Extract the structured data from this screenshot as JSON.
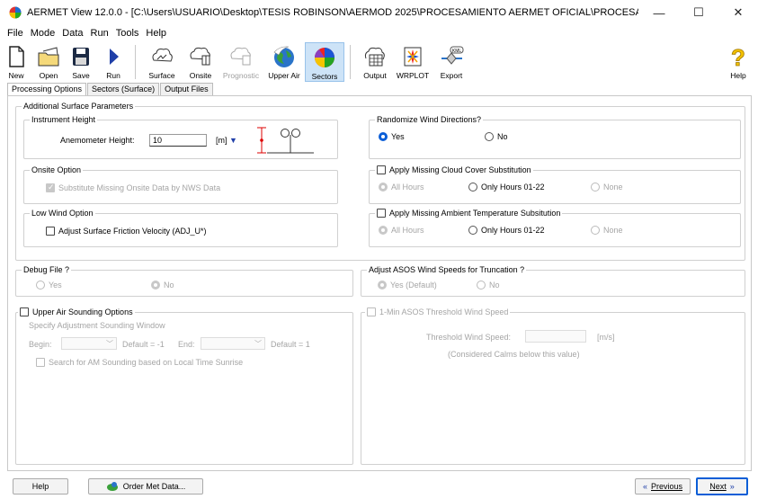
{
  "window": {
    "title": "AERMET View 12.0.0 - [C:\\Users\\USUARIO\\Desktop\\TESIS ROBINSON\\AERMOD 2025\\PROCESAMIENTO AERMET OFICIAL\\PROCESAMIENT...",
    "controls": [
      "—",
      "☐",
      "✕"
    ]
  },
  "menu": [
    "File",
    "Mode",
    "Data",
    "Run",
    "Tools",
    "Help"
  ],
  "toolbar": {
    "new": "New",
    "open": "Open",
    "save": "Save",
    "run": "Run",
    "surface": "Surface",
    "onsite": "Onsite",
    "prognostic": "Prognostic",
    "upper_air": "Upper Air",
    "sectors": "Sectors",
    "output": "Output",
    "wrplot": "WRPLOT",
    "export": "Export",
    "help": "Help"
  },
  "tabs": [
    "Processing Options",
    "Sectors (Surface)",
    "Output Files"
  ],
  "additional": {
    "title": "Additional Surface Parameters",
    "instrument": {
      "title": "Instrument Height",
      "label": "Anemometer Height:",
      "value": "10",
      "unit": "[m]"
    },
    "onsite": {
      "title": "Onsite Option",
      "substitute": "Substitute Missing Onsite Data by NWS Data"
    },
    "lowwind": {
      "title": "Low Wind Option",
      "adjust": "Adjust Surface Friction Velocity (ADJ_U*)"
    },
    "randomize": {
      "title": "Randomize Wind Directions?",
      "yes": "Yes",
      "no": "No",
      "selected": "Yes"
    },
    "cloud": {
      "title": "Apply Missing Cloud Cover Substitution",
      "opt1": "All Hours",
      "opt2": "Only Hours 01-22",
      "opt3": "None"
    },
    "temp": {
      "title": "Apply Missing Ambient Temperature Subsitution",
      "opt1": "All Hours",
      "opt2": "Only Hours 01-22",
      "opt3": "None"
    }
  },
  "debug": {
    "title": "Debug File ?",
    "yes": "Yes",
    "no": "No",
    "selected": "No"
  },
  "asos": {
    "title": "Adjust ASOS Wind Speeds for Truncation ?",
    "yes": "Yes (Default)",
    "no": "No",
    "selected": "Yes (Default)"
  },
  "upper_air": {
    "title": "Upper Air Sounding Options",
    "window_label": "Specify Adjustment Sounding Window",
    "begin": "Begin:",
    "begin_default": "Default = -1",
    "end": "End:",
    "end_default": "Default = 1",
    "search": "Search for AM Sounding based on Local Time Sunrise"
  },
  "one_min": {
    "title": "1-Min ASOS Threshold Wind Speed",
    "label": "Threshold Wind Speed:",
    "unit": "[m/s]",
    "note": "(Considered Calms below this value)"
  },
  "bottom": {
    "help": "Help",
    "order": "Order Met Data...",
    "previous": "Previous",
    "next": "Next"
  }
}
